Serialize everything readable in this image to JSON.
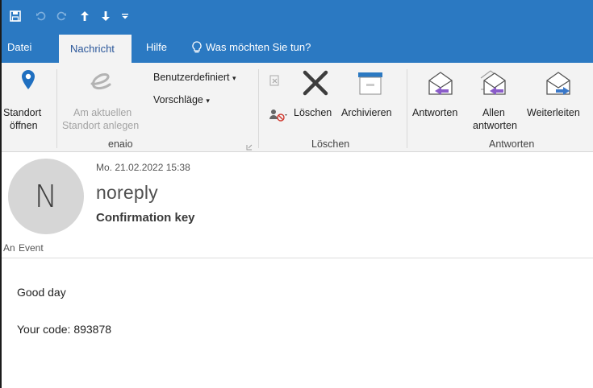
{
  "quick_access": {
    "save_icon": "save-icon",
    "undo_icon": "undo-icon",
    "redo_icon": "redo-icon",
    "up_icon": "arrow-up-icon",
    "down_icon": "arrow-down-icon",
    "customize_icon": "customize-qat-icon"
  },
  "tabs": [
    {
      "label": "Datei"
    },
    {
      "label": "Nachricht"
    },
    {
      "label": "Hilfe"
    }
  ],
  "tell_me": {
    "label": "Was möchten Sie tun?",
    "icon": "lightbulb-icon"
  },
  "ribbon": {
    "standort_oeffnen": {
      "line1": "Standort",
      "line2": "öffnen",
      "icon": "location-pin-icon"
    },
    "standort_anlegen": {
      "line1": "Am aktuellen",
      "line2": "Standort anlegen",
      "icon": "enaio-e-icon"
    },
    "benutzerdefiniert": {
      "label": "Benutzerdefiniert"
    },
    "vorschlaege": {
      "label": "Vorschläge"
    },
    "group_enaio": "enaio",
    "loeschen": {
      "label": "Löschen",
      "icon": "delete-x-icon"
    },
    "archivieren": {
      "label": "Archivieren",
      "icon": "archive-icon"
    },
    "group_loeschen": "Löschen",
    "antworten": {
      "label": "Antworten",
      "icon": "reply-icon"
    },
    "allen_antworten": {
      "line1": "Allen",
      "line2": "antworten",
      "icon": "reply-all-icon"
    },
    "weiterleiten": {
      "label": "Weiterleiten",
      "icon": "forward-icon"
    },
    "group_antworten": "Antworten"
  },
  "message": {
    "avatar_initial": "N",
    "date": "Mo. 21.02.2022 15:38",
    "sender": "noreply",
    "subject": "Confirmation key",
    "to_label": "An",
    "to_value": "Event"
  },
  "body": {
    "line1": "Good day",
    "line2": "Your code: 893878"
  },
  "colors": {
    "accent": "#2b79c2",
    "ribbon_bg": "#f3f3f3",
    "active_tab_text": "#2b579a",
    "reply_arrow": "#8a5cc9",
    "forward_arrow": "#3a78c9"
  }
}
